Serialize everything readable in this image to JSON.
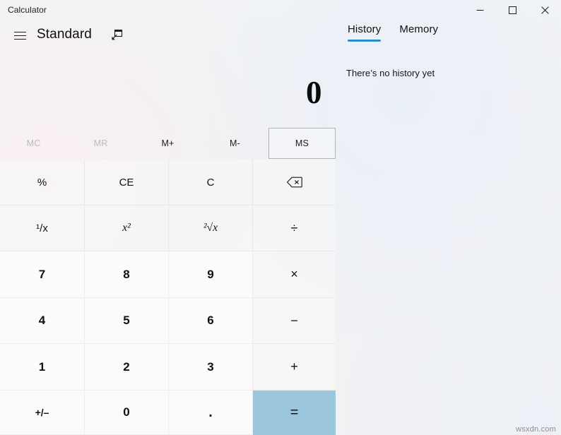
{
  "window": {
    "title": "Calculator",
    "controls": [
      {
        "name": "minimize",
        "label": "—"
      },
      {
        "name": "maximize",
        "label": "□"
      },
      {
        "name": "close",
        "label": "✕"
      }
    ]
  },
  "header": {
    "menu_label": "navigation-menu",
    "mode": "Standard",
    "keep_on_top_label": "Keep on top"
  },
  "display": {
    "value": "0"
  },
  "memory": {
    "buttons": [
      {
        "label": "MC",
        "state": "disabled"
      },
      {
        "label": "MR",
        "state": "disabled"
      },
      {
        "label": "M+",
        "state": "enabled"
      },
      {
        "label": "M-",
        "state": "enabled"
      },
      {
        "label": "MS",
        "state": "hovered"
      }
    ]
  },
  "keypad": {
    "rows": [
      [
        {
          "label": "%",
          "kind": "fn",
          "name": "percent"
        },
        {
          "label": "CE",
          "kind": "fn",
          "name": "clear-entry"
        },
        {
          "label": "C",
          "kind": "fn",
          "name": "clear"
        },
        {
          "label": "",
          "kind": "fn",
          "name": "backspace",
          "icon": "backspace-icon"
        }
      ],
      [
        {
          "label": "¹/x",
          "kind": "fn",
          "name": "reciprocal"
        },
        {
          "label": "x²",
          "kind": "fn",
          "name": "square"
        },
        {
          "label": "²√x",
          "kind": "fn",
          "name": "square-root"
        },
        {
          "label": "÷",
          "kind": "op",
          "name": "divide"
        }
      ],
      [
        {
          "label": "7",
          "kind": "num",
          "name": "seven"
        },
        {
          "label": "8",
          "kind": "num",
          "name": "eight"
        },
        {
          "label": "9",
          "kind": "num",
          "name": "nine"
        },
        {
          "label": "×",
          "kind": "op",
          "name": "multiply"
        }
      ],
      [
        {
          "label": "4",
          "kind": "num",
          "name": "four"
        },
        {
          "label": "5",
          "kind": "num",
          "name": "five"
        },
        {
          "label": "6",
          "kind": "num",
          "name": "six"
        },
        {
          "label": "−",
          "kind": "op",
          "name": "minus"
        }
      ],
      [
        {
          "label": "1",
          "kind": "num",
          "name": "one"
        },
        {
          "label": "2",
          "kind": "num",
          "name": "two"
        },
        {
          "label": "3",
          "kind": "num",
          "name": "three"
        },
        {
          "label": "+",
          "kind": "op",
          "name": "plus"
        }
      ],
      [
        {
          "label": "+/–",
          "kind": "num",
          "name": "negate"
        },
        {
          "label": "0",
          "kind": "num",
          "name": "zero"
        },
        {
          "label": ".",
          "kind": "num",
          "name": "decimal"
        },
        {
          "label": "=",
          "kind": "equals",
          "name": "equals"
        }
      ]
    ]
  },
  "right_pane": {
    "tabs": [
      {
        "label": "History",
        "active": true
      },
      {
        "label": "Memory",
        "active": false
      }
    ],
    "empty_message": "There’s no history yet"
  },
  "watermark": "wsxdn.com",
  "colors": {
    "accent": "#2e8bc9",
    "equals": "#9cc6de",
    "disabled_text": "#bcbcbc"
  }
}
